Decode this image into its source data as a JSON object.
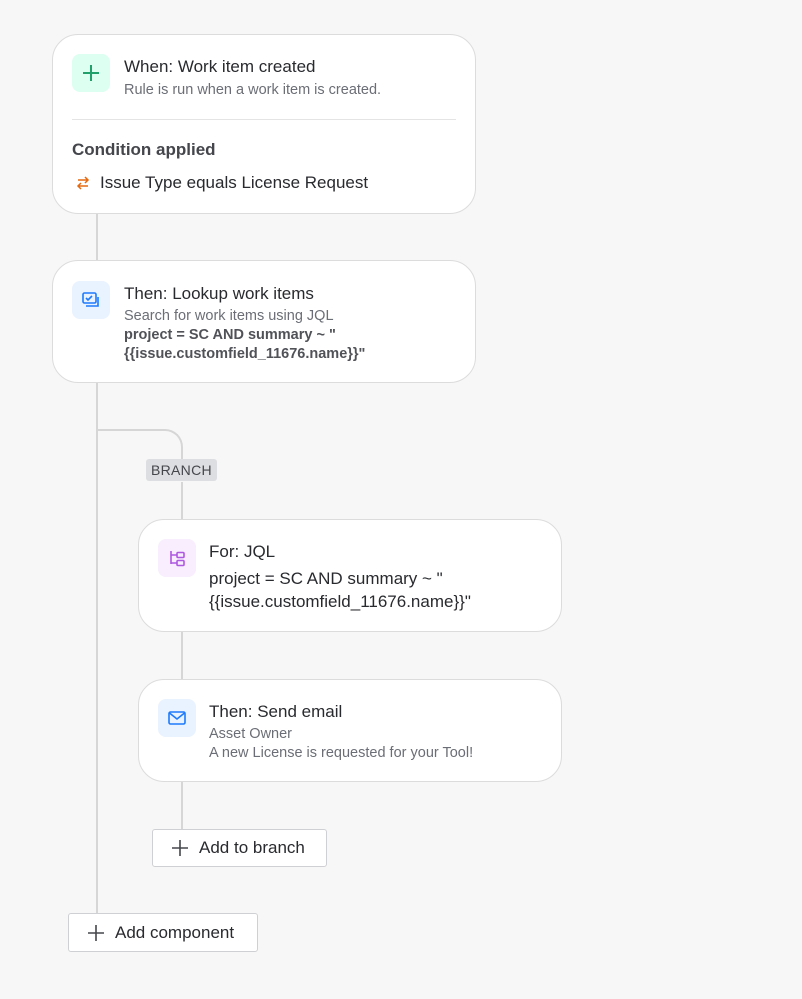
{
  "trigger": {
    "title": "When: Work item created",
    "subtitle": "Rule is run when a work item is created.",
    "condition_heading": "Condition applied",
    "condition_text": "Issue Type equals License Request",
    "icon": "plus-icon",
    "icon_color": "#22a06b"
  },
  "lookup": {
    "title": "Then: Lookup work items",
    "subtitle": "Search for work items using JQL",
    "query_line1": "project = SC AND summary ~ \"",
    "query_line2": "{{issue.customfield_11676.name}}\"",
    "icon": "lookup-icon",
    "icon_color": "#1d7afc"
  },
  "branch": {
    "badge": "BRANCH",
    "for_card": {
      "title": "For: JQL",
      "line1": "project = SC AND summary ~ \"",
      "line2": "{{issue.customfield_11676.name}}\"",
      "icon": "branch-icon",
      "icon_color": "#af59e1"
    },
    "email_card": {
      "title": "Then: Send email",
      "line1": "Asset Owner",
      "line2": "A new License is requested for your Tool!",
      "icon": "mail-icon",
      "icon_color": "#1d7afc"
    },
    "add_button": "Add to branch"
  },
  "add_component_button": "Add component"
}
